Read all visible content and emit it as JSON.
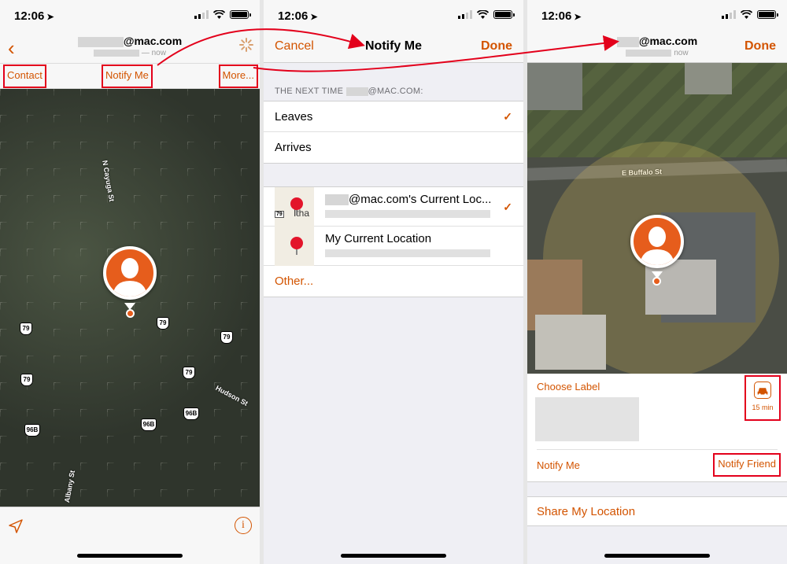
{
  "status_bar": {
    "time": "12:06"
  },
  "panel1": {
    "title_suffix": "@mac.com",
    "subtitle": "— now",
    "actions": {
      "contact": "Contact",
      "notify_me": "Notify Me",
      "more": "More..."
    },
    "map_labels": {
      "street_cayuga": "N Cayuga St",
      "street_hudson": "Hudson St",
      "street_albany": "Albany St",
      "route_79": "79",
      "route_96b": "96B"
    }
  },
  "panel2": {
    "nav": {
      "cancel": "Cancel",
      "title": "Notify Me",
      "done": "Done"
    },
    "section_header_prefix": "THE NEXT TIME",
    "section_header_suffix": "@MAC.COM:",
    "options": [
      "Leaves",
      "Arrives"
    ],
    "locations": [
      {
        "label": "@mac.com's Current Loc...",
        "selected": true,
        "map_text": "Itha",
        "map_tag": "79"
      },
      {
        "label": "My Current Location",
        "selected": false
      }
    ],
    "other": "Other..."
  },
  "panel3": {
    "title_suffix": "@mac.com",
    "subtitle": "now",
    "done": "Done",
    "map_street": "E Buffalo St",
    "choose_label": "Choose Label",
    "travel_time": "15 min",
    "notify_me": "Notify Me",
    "notify_friend": "Notify Friend",
    "share_location": "Share My Location"
  },
  "colors": {
    "accent": "#d35400",
    "highlight_box": "#e3001b",
    "pin": "#e65d1c"
  }
}
